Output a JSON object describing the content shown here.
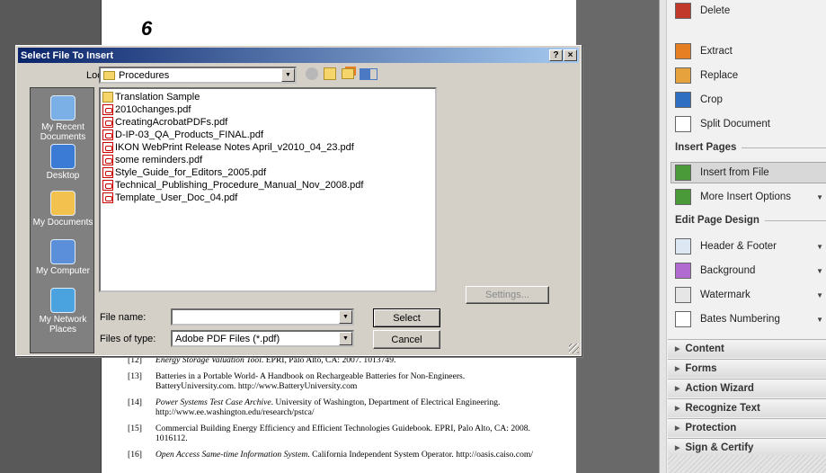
{
  "document": {
    "page_number": "6",
    "references": [
      {
        "num": "[12]",
        "text": "Energy Storage Valuation Tool. EPRI, Palo Alto, CA: 2007. 1013749."
      },
      {
        "num": "[13]",
        "text": "Batteries in a Portable World- A Handbook on Rechargeable Batteries for Non-Engineers. BatteryUniversity.com. http://www.BatteryUniversity.com"
      },
      {
        "num": "[14]",
        "text": "Power Systems Test Case Archive. University of Washington, Department of Electrical Engineering. http://www.ee.washington.edu/research/pstca/"
      },
      {
        "num": "[15]",
        "text": "Commercial Building Energy Efficiency and Efficient Technologies Guidebook. EPRI, Palo Alto, CA: 2008. 1016112."
      },
      {
        "num": "[16]",
        "text": "Open Access Same-time Information System. California Independent System Operator. http://oasis.caiso.com/"
      }
    ]
  },
  "panel": {
    "page_tools": [
      {
        "label": "Delete",
        "icon": "delete-page-icon"
      },
      {
        "label": "Extract",
        "icon": "extract-page-icon"
      },
      {
        "label": "Replace",
        "icon": "replace-page-icon"
      },
      {
        "label": "Crop",
        "icon": "crop-icon"
      },
      {
        "label": "Split Document",
        "icon": "split-document-icon"
      }
    ],
    "insert_pages_title": "Insert Pages",
    "insert_items": [
      {
        "label": "Insert from File",
        "icon": "insert-file-icon"
      },
      {
        "label": "More Insert Options",
        "icon": "more-insert-icon"
      }
    ],
    "edit_design_title": "Edit Page Design",
    "design_items": [
      {
        "label": "Header & Footer",
        "icon": "header-footer-icon"
      },
      {
        "label": "Background",
        "icon": "background-icon"
      },
      {
        "label": "Watermark",
        "icon": "watermark-icon"
      },
      {
        "label": "Bates Numbering",
        "icon": "bates-numbering-icon"
      }
    ],
    "accordions": [
      "Content",
      "Forms",
      "Action Wizard",
      "Recognize Text",
      "Protection",
      "Sign & Certify"
    ]
  },
  "dialog": {
    "title": "Select File To Insert",
    "help_btn": "?",
    "close_btn": "×",
    "look_in_label": "Look in:",
    "look_in_value": "Procedures",
    "places": [
      "My Recent Documents",
      "Desktop",
      "My Documents",
      "My Computer",
      "My Network Places"
    ],
    "files": [
      {
        "name": "Translation Sample",
        "type": "folder"
      },
      {
        "name": "2010changes.pdf",
        "type": "pdf"
      },
      {
        "name": "CreatingAcrobatPDFs.pdf",
        "type": "pdf"
      },
      {
        "name": "D-IP-03_QA_Products_FINAL.pdf",
        "type": "pdf"
      },
      {
        "name": "IKON WebPrint Release Notes April_v2010_04_23.pdf",
        "type": "pdf"
      },
      {
        "name": "some reminders.pdf",
        "type": "pdf"
      },
      {
        "name": "Style_Guide_for_Editors_2005.pdf",
        "type": "pdf"
      },
      {
        "name": "Technical_Publishing_Procedure_Manual_Nov_2008.pdf",
        "type": "pdf"
      },
      {
        "name": "Template_User_Doc_04.pdf",
        "type": "pdf"
      }
    ],
    "settings_label": "Settings...",
    "file_name_label": "File name:",
    "file_name_value": "",
    "files_of_type_label": "Files of type:",
    "files_of_type_value": "Adobe PDF Files (*.pdf)",
    "select_label": "Select",
    "cancel_label": "Cancel"
  }
}
